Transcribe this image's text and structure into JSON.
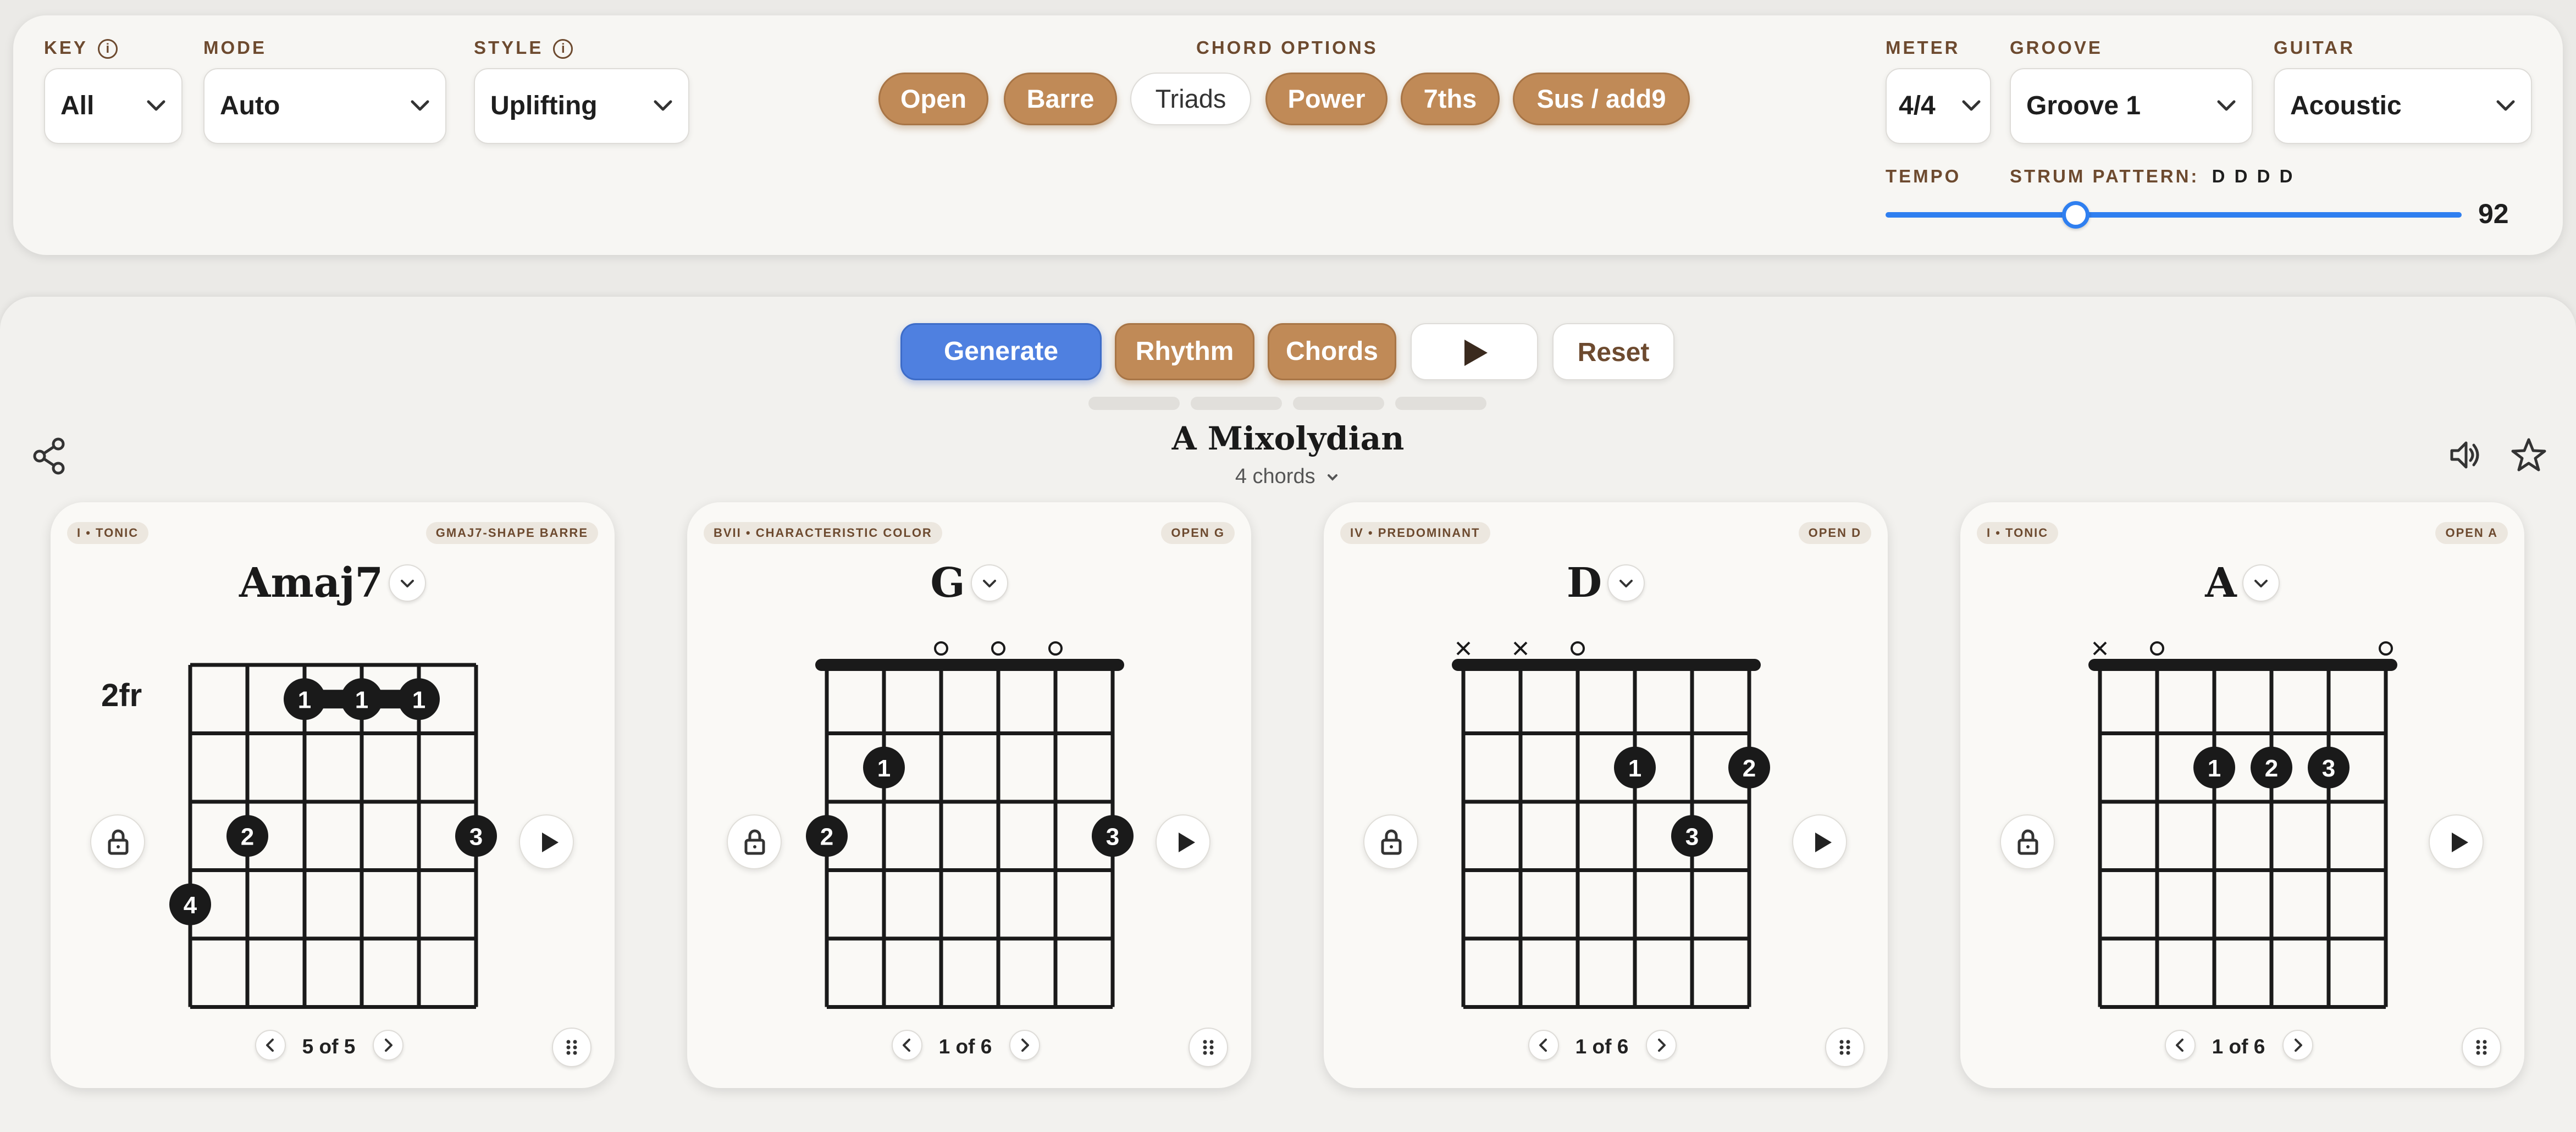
{
  "controls": {
    "key": {
      "label": "KEY",
      "value": "All"
    },
    "mode": {
      "label": "MODE",
      "value": "Auto"
    },
    "style": {
      "label": "STYLE",
      "value": "Uplifting"
    },
    "chord_options": {
      "label": "CHORD OPTIONS",
      "options": [
        {
          "label": "Open",
          "active": true
        },
        {
          "label": "Barre",
          "active": true
        },
        {
          "label": "Triads",
          "active": false
        },
        {
          "label": "Power",
          "active": true
        },
        {
          "label": "7ths",
          "active": true
        },
        {
          "label": "Sus / add9",
          "active": true
        }
      ]
    },
    "meter": {
      "label": "METER",
      "value": "4/4"
    },
    "groove": {
      "label": "GROOVE",
      "value": "Groove 1"
    },
    "guitar": {
      "label": "GUITAR",
      "value": "Acoustic"
    },
    "tempo": {
      "label": "TEMPO",
      "value": "92",
      "fraction": 0.33
    },
    "strum": {
      "label": "STRUM PATTERN:",
      "value": "D D D D"
    }
  },
  "actions": {
    "generate": "Generate",
    "rhythm": "Rhythm",
    "chords": "Chords",
    "reset": "Reset"
  },
  "progression": {
    "title": "A Mixolydian",
    "count": "4 chords"
  },
  "colors": {
    "accent": "#c08a57",
    "primary": "#4f80e0",
    "brown_text": "#6d4a2f",
    "slider": "#2f7ff0"
  },
  "cards": [
    {
      "function": "I • TONIC",
      "shape": "GMAJ7-SHAPE BARRE",
      "name": "Amaj7",
      "pager": "5 of 5",
      "fret_label": "2fr",
      "nut": false,
      "markers": [
        "",
        "",
        "",
        "",
        "",
        ""
      ],
      "barre": {
        "fret": 1,
        "from": 2,
        "to": 4
      },
      "dots": [
        {
          "s": 2,
          "f": 1,
          "n": "1"
        },
        {
          "s": 3,
          "f": 1,
          "n": "1"
        },
        {
          "s": 4,
          "f": 1,
          "n": "1"
        },
        {
          "s": 1,
          "f": 3,
          "n": "2"
        },
        {
          "s": 5,
          "f": 3,
          "n": "3"
        },
        {
          "s": 0,
          "f": 4,
          "n": "4"
        }
      ]
    },
    {
      "function": "BVII • CHARACTERISTIC COLOR",
      "shape": "OPEN G",
      "name": "G",
      "pager": "1 of 6",
      "fret_label": "",
      "nut": true,
      "markers": [
        "",
        "",
        "o",
        "o",
        "o",
        ""
      ],
      "dots": [
        {
          "s": 1,
          "f": 2,
          "n": "1"
        },
        {
          "s": 0,
          "f": 3,
          "n": "2"
        },
        {
          "s": 5,
          "f": 3,
          "n": "3"
        }
      ]
    },
    {
      "function": "IV • PREDOMINANT",
      "shape": "OPEN D",
      "name": "D",
      "pager": "1 of 6",
      "fret_label": "",
      "nut": true,
      "markers": [
        "x",
        "x",
        "o",
        "",
        "",
        ""
      ],
      "dots": [
        {
          "s": 3,
          "f": 2,
          "n": "1"
        },
        {
          "s": 5,
          "f": 2,
          "n": "2"
        },
        {
          "s": 4,
          "f": 3,
          "n": "3"
        }
      ]
    },
    {
      "function": "I • TONIC",
      "shape": "OPEN A",
      "name": "A",
      "pager": "1 of 6",
      "fret_label": "",
      "nut": true,
      "markers": [
        "x",
        "o",
        "",
        "",
        "",
        "o"
      ],
      "dots": [
        {
          "s": 2,
          "f": 2,
          "n": "1"
        },
        {
          "s": 3,
          "f": 2,
          "n": "2"
        },
        {
          "s": 4,
          "f": 2,
          "n": "3"
        }
      ]
    }
  ]
}
